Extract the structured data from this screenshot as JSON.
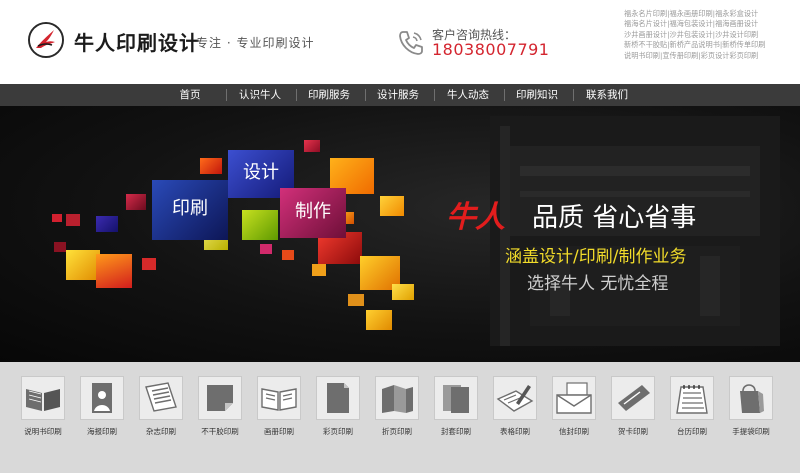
{
  "header": {
    "brand_name": "牛人印刷设计",
    "slogan": "专注 · 专业印刷设计",
    "hotline_label": "客户咨询热线：",
    "hotline_number": "18038007791",
    "keyword_lines": [
      "福永名片印刷|福永画册印刷|福永彩盒设计",
      "福海名片设计|福海包装设计|福海画册设计",
      "沙井画册设计|沙井包装设计|沙井设计印刷",
      "新桥不干胶贴|新桥产品说明书|新桥传单印刷",
      "说明书印刷|宣传册印刷|彩页设计彩页印刷"
    ]
  },
  "nav": {
    "items": [
      "首页",
      "认识牛人",
      "印刷服务",
      "设计服务",
      "牛人动态",
      "印刷知识",
      "联系我们"
    ]
  },
  "banner": {
    "tile_labels": [
      "设计",
      "印刷",
      "制作"
    ],
    "brand_text": "牛人",
    "headline": "品质  省心省事",
    "subline": "涵盖设计/印刷/制作业务",
    "tagline": "选择牛人 无忧全程",
    "colors": {
      "brand": "#e21d1d",
      "subline": "#f2dc2a",
      "accent": "#d4252f"
    }
  },
  "products": [
    {
      "label": "说明书印刷",
      "icon": "open-book-icon"
    },
    {
      "label": "海报印刷",
      "icon": "poster-icon"
    },
    {
      "label": "杂志印刷",
      "icon": "magazine-icon"
    },
    {
      "label": "不干胶印刷",
      "icon": "sticker-icon"
    },
    {
      "label": "画册印刷",
      "icon": "album-icon"
    },
    {
      "label": "彩页印刷",
      "icon": "color-page-icon"
    },
    {
      "label": "折页印刷",
      "icon": "folded-leaflet-icon"
    },
    {
      "label": "封套印刷",
      "icon": "folder-icon"
    },
    {
      "label": "表格印刷",
      "icon": "form-pen-icon"
    },
    {
      "label": "信封印刷",
      "icon": "envelope-icon"
    },
    {
      "label": "贺卡印刷",
      "icon": "greeting-card-icon"
    },
    {
      "label": "台历印刷",
      "icon": "desk-calendar-icon"
    },
    {
      "label": "手提袋印刷",
      "icon": "tote-bag-icon"
    }
  ]
}
